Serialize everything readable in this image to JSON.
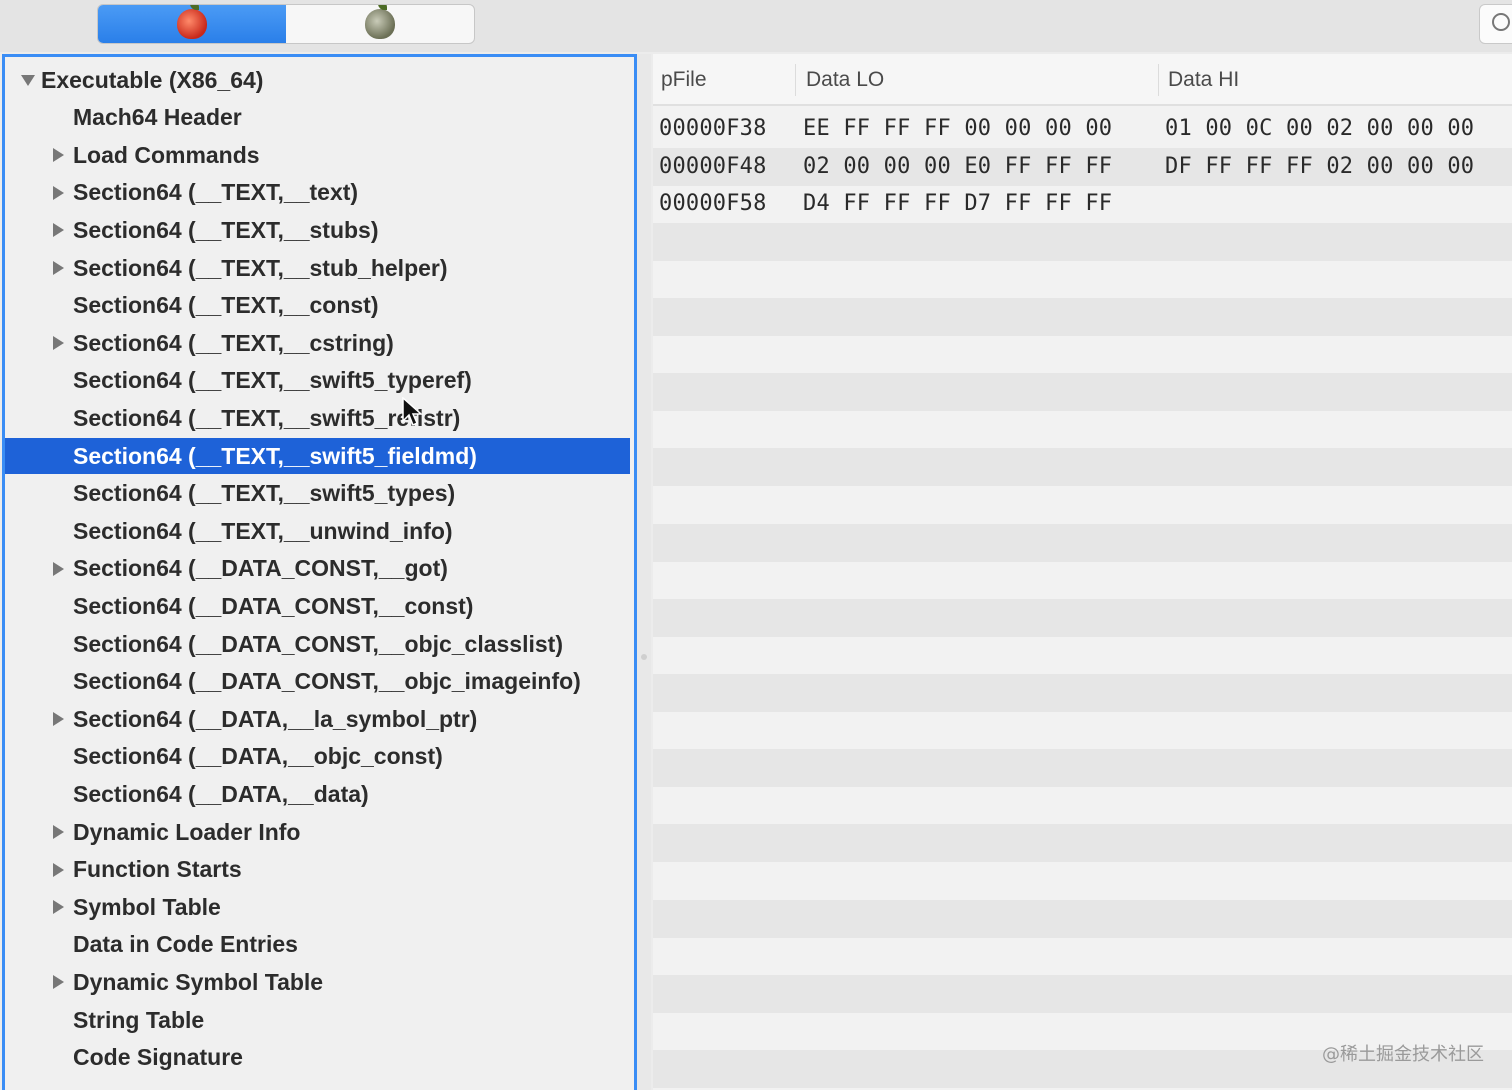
{
  "toolbar": {
    "segments": [
      {
        "icon": "apple-red-icon",
        "active": true
      },
      {
        "icon": "apple-gray-icon",
        "active": false
      }
    ],
    "search_icon": "search-icon"
  },
  "outline": {
    "items": [
      {
        "label": "Executable  (X86_64)",
        "level": 0,
        "disclosure": "expanded"
      },
      {
        "label": "Mach64 Header",
        "level": 1,
        "disclosure": "none"
      },
      {
        "label": "Load Commands",
        "level": 1,
        "disclosure": "collapsed"
      },
      {
        "label": "Section64 (__TEXT,__text)",
        "level": 1,
        "disclosure": "collapsed"
      },
      {
        "label": "Section64 (__TEXT,__stubs)",
        "level": 1,
        "disclosure": "collapsed"
      },
      {
        "label": "Section64 (__TEXT,__stub_helper)",
        "level": 1,
        "disclosure": "collapsed"
      },
      {
        "label": "Section64 (__TEXT,__const)",
        "level": 1,
        "disclosure": "none"
      },
      {
        "label": "Section64 (__TEXT,__cstring)",
        "level": 1,
        "disclosure": "collapsed"
      },
      {
        "label": "Section64 (__TEXT,__swift5_typeref)",
        "level": 1,
        "disclosure": "none"
      },
      {
        "label": "Section64 (__TEXT,__swift5_reflstr)",
        "level": 1,
        "disclosure": "none"
      },
      {
        "label": "Section64 (__TEXT,__swift5_fieldmd)",
        "level": 1,
        "disclosure": "none",
        "selected": true
      },
      {
        "label": "Section64 (__TEXT,__swift5_types)",
        "level": 1,
        "disclosure": "none"
      },
      {
        "label": "Section64 (__TEXT,__unwind_info)",
        "level": 1,
        "disclosure": "none"
      },
      {
        "label": "Section64 (__DATA_CONST,__got)",
        "level": 1,
        "disclosure": "collapsed"
      },
      {
        "label": "Section64 (__DATA_CONST,__const)",
        "level": 1,
        "disclosure": "none"
      },
      {
        "label": "Section64 (__DATA_CONST,__objc_classlist)",
        "level": 1,
        "disclosure": "none"
      },
      {
        "label": "Section64 (__DATA_CONST,__objc_imageinfo)",
        "level": 1,
        "disclosure": "none"
      },
      {
        "label": "Section64 (__DATA,__la_symbol_ptr)",
        "level": 1,
        "disclosure": "collapsed"
      },
      {
        "label": "Section64 (__DATA,__objc_const)",
        "level": 1,
        "disclosure": "none"
      },
      {
        "label": "Section64 (__DATA,__data)",
        "level": 1,
        "disclosure": "none"
      },
      {
        "label": "Dynamic Loader Info",
        "level": 1,
        "disclosure": "collapsed"
      },
      {
        "label": "Function Starts",
        "level": 1,
        "disclosure": "collapsed"
      },
      {
        "label": "Symbol Table",
        "level": 1,
        "disclosure": "collapsed"
      },
      {
        "label": "Data in Code Entries",
        "level": 1,
        "disclosure": "none"
      },
      {
        "label": "Dynamic Symbol Table",
        "level": 1,
        "disclosure": "collapsed"
      },
      {
        "label": "String Table",
        "level": 1,
        "disclosure": "none"
      },
      {
        "label": "Code Signature",
        "level": 1,
        "disclosure": "none"
      }
    ]
  },
  "table": {
    "columns": [
      "pFile",
      "Data LO",
      "Data HI"
    ],
    "rows": [
      {
        "pfile": "00000F38",
        "lo": "EE FF FF FF 00 00 00 00",
        "hi": "01 00 0C 00 02 00 00 00"
      },
      {
        "pfile": "00000F48",
        "lo": "02 00 00 00 E0 FF FF FF",
        "hi": "DF FF FF FF 02 00 00 00"
      },
      {
        "pfile": "00000F58",
        "lo": "D4 FF FF FF D7 FF FF FF",
        "hi": ""
      }
    ]
  },
  "watermark": "@稀土掘金技术社区"
}
